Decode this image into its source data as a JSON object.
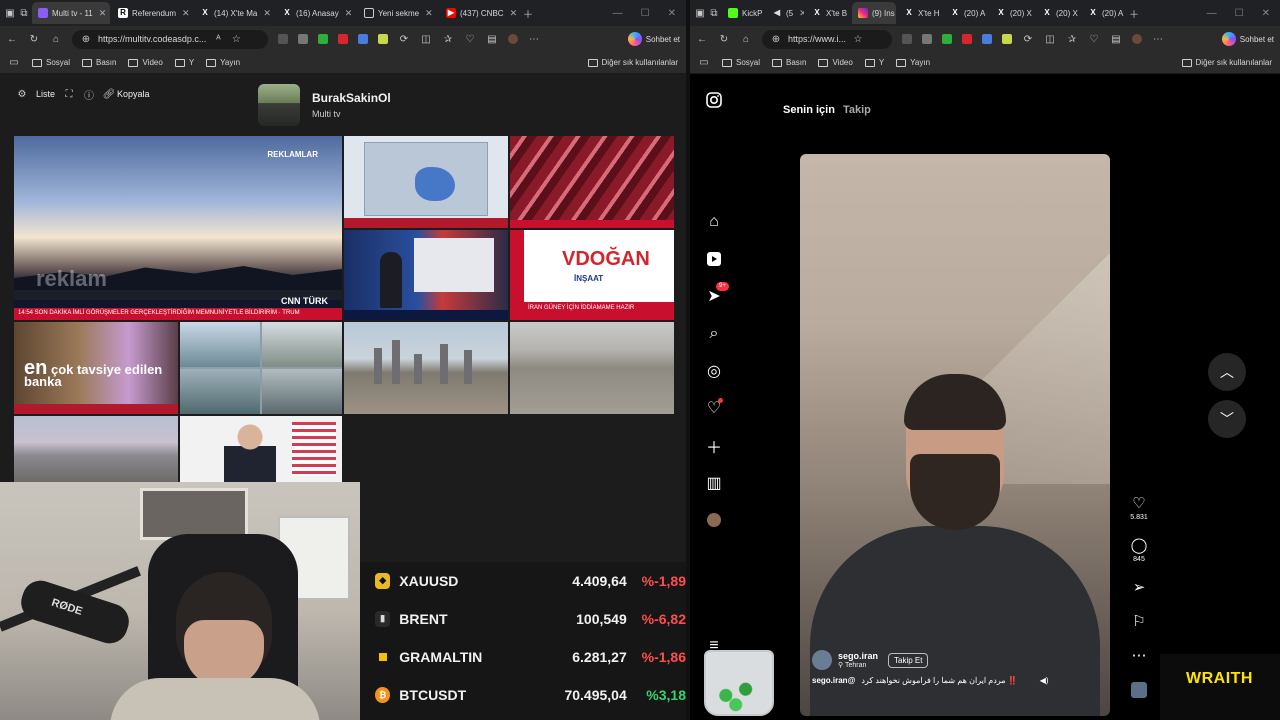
{
  "left_browser": {
    "tabs": [
      {
        "label": "Multi tv - 11",
        "active": true
      },
      {
        "label": "Referendum"
      },
      {
        "label": "(14) X'te Ma"
      },
      {
        "label": "(16) Anasay"
      },
      {
        "label": "Yeni sekme"
      },
      {
        "label": "(437) CNBC"
      }
    ],
    "url": "https://multitv.codeasdp.c...",
    "chat_label": "Sohbet et",
    "bookmarks": [
      "Sosyal",
      "Basın",
      "Video",
      "Y",
      "Yayın"
    ],
    "bookmarks_other": "Diğer sık kullanılanlar"
  },
  "multitv": {
    "toolbar": {
      "list_label": "Liste",
      "copy_label": "Kopyala"
    },
    "profile": {
      "name": "BurakSakinOl",
      "subtitle": "Multi tv"
    },
    "tiles": {
      "main_tag": "REKLAMLAR",
      "main_overlay": "reklam",
      "main_ticker": "14:54  SON DAKİKA  İMLİ GÖRÜŞMELER GERÇEKLEŞTİRDİĞİM MEMNUNİYETLE BİLDİRİRİM · TRUM",
      "main_brand": "CNN TÜRK",
      "dogan_logo": "VDOĞAN",
      "dogan_sub": "İNŞAAT",
      "dogan_bar": "İRAN GÜNEY İÇİN İDDİAMAME HAZIR",
      "ad_text_big": "en",
      "ad_text": "çok tavsiye edilen banka"
    }
  },
  "ticker": [
    {
      "symbol": "XAUUSD",
      "value": "4.409,64",
      "change": "%-1,89",
      "direction": "down",
      "icon_color": "#e8b923"
    },
    {
      "symbol": "BRENT",
      "value": "100,549",
      "change": "%-6,82",
      "direction": "down",
      "icon_color": "#2a2a2a"
    },
    {
      "symbol": "GRAMALTIN",
      "value": "6.281,27",
      "change": "%-1,86",
      "direction": "down",
      "icon_color": "#f2c400"
    },
    {
      "symbol": "BTCUSDT",
      "value": "70.495,04",
      "change": "%3,18",
      "direction": "up",
      "icon_color": "#f7931a"
    }
  ],
  "webcam": {
    "mic_brand": "RØDE"
  },
  "right_browser": {
    "tabs": [
      {
        "label": "KickP"
      },
      {
        "label": "(5"
      },
      {
        "label": "X'te B"
      },
      {
        "label": "(9) Ins",
        "active": true
      },
      {
        "label": "X'te H"
      },
      {
        "label": "(20) A"
      },
      {
        "label": "(20) X"
      },
      {
        "label": "(20) X"
      },
      {
        "label": "(20) A"
      }
    ],
    "url": "https://www.i...",
    "chat_label": "Sohbet et",
    "bookmarks": [
      "Sosyal",
      "Basın",
      "Video",
      "Y",
      "Yayın"
    ],
    "bookmarks_other": "Diğer sık kullanılanlar"
  },
  "instagram": {
    "feed_tabs": {
      "for_you": "Senin için",
      "following": "Takip"
    },
    "notifications_badge": "9+",
    "post": {
      "username": "sego.iran",
      "location": "Tehran",
      "follow_label": "Takip Et",
      "caption_user": "sego.iran@",
      "caption": "مردم ایران هم شما را فراموش نخواهند کرد ‼️",
      "likes": "5.831",
      "comments": "845"
    }
  },
  "overlay": {
    "brand": "WRAITH"
  }
}
